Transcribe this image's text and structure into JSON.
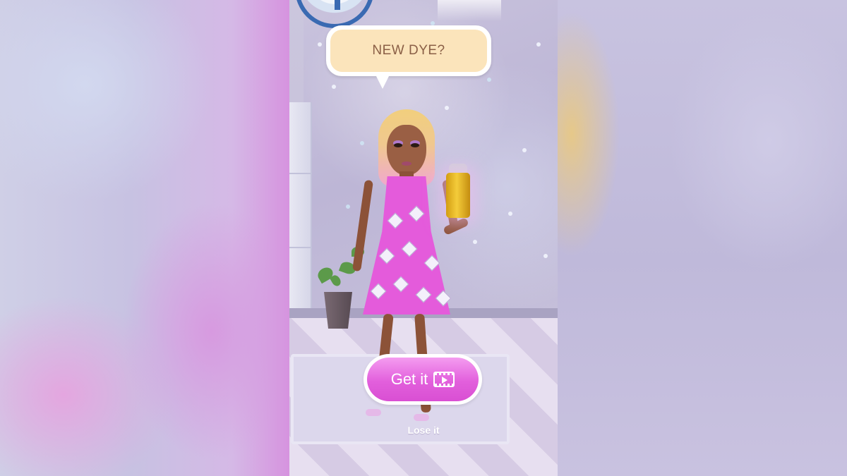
{
  "dialog": {
    "prompt": "NEW DYE?"
  },
  "actions": {
    "get_label": "Get it",
    "get_icon": "video-ad-icon",
    "lose_label": "Lose it"
  },
  "item": {
    "icon": "spray-can-icon",
    "color": "#e8b622"
  },
  "colors": {
    "button_pink": "#e25fdc",
    "bubble_fill": "#fbe4bb",
    "bubble_text": "#8a5f46"
  }
}
